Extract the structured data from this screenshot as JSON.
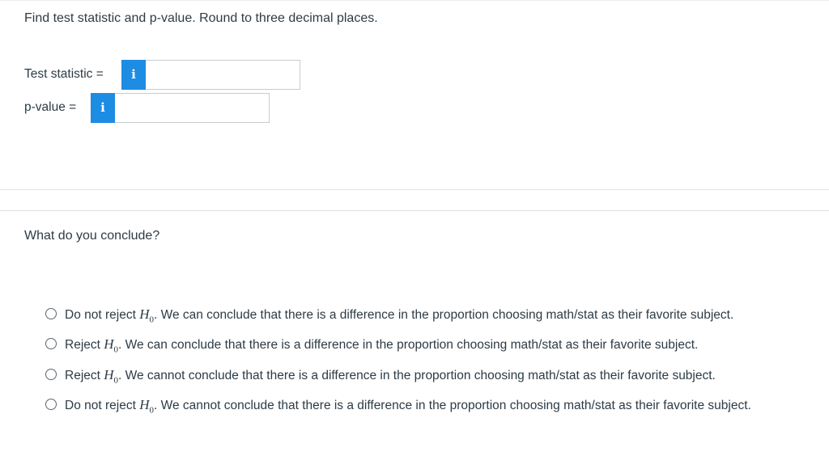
{
  "instructions": "Find test statistic and p-value. Round to three decimal places.",
  "fields": {
    "test_statistic": {
      "label": "Test statistic =",
      "info_glyph": "i",
      "value": "",
      "placeholder": ""
    },
    "p_value": {
      "label": "p-value =",
      "info_glyph": "i",
      "value": "",
      "placeholder": ""
    }
  },
  "question": "What do you conclude?",
  "hypothesis": {
    "symbol": "H",
    "subscript": "0"
  },
  "choices": [
    {
      "prefix": "Do not reject",
      "suffix": ". We can conclude that there is a difference in the proportion choosing math/stat as their favorite subject."
    },
    {
      "prefix": "Reject",
      "suffix": ". We can conclude that there is a difference in the proportion choosing math/stat as their favorite subject."
    },
    {
      "prefix": "Reject",
      "suffix": ". We cannot conclude that there is a difference in the proportion choosing math/stat as their favorite subject."
    },
    {
      "prefix": "Do not reject",
      "suffix": ". We cannot conclude that there is a difference in the proportion choosing math/stat as their favorite subject."
    }
  ],
  "colors": {
    "info_button": "#1d8ce3",
    "text": "#2d3b45",
    "input_border": "#c7cdd1",
    "separator": "#dfe3e6"
  },
  "icons": {
    "info": "info-icon",
    "radio": "radio-unselected-icon"
  }
}
